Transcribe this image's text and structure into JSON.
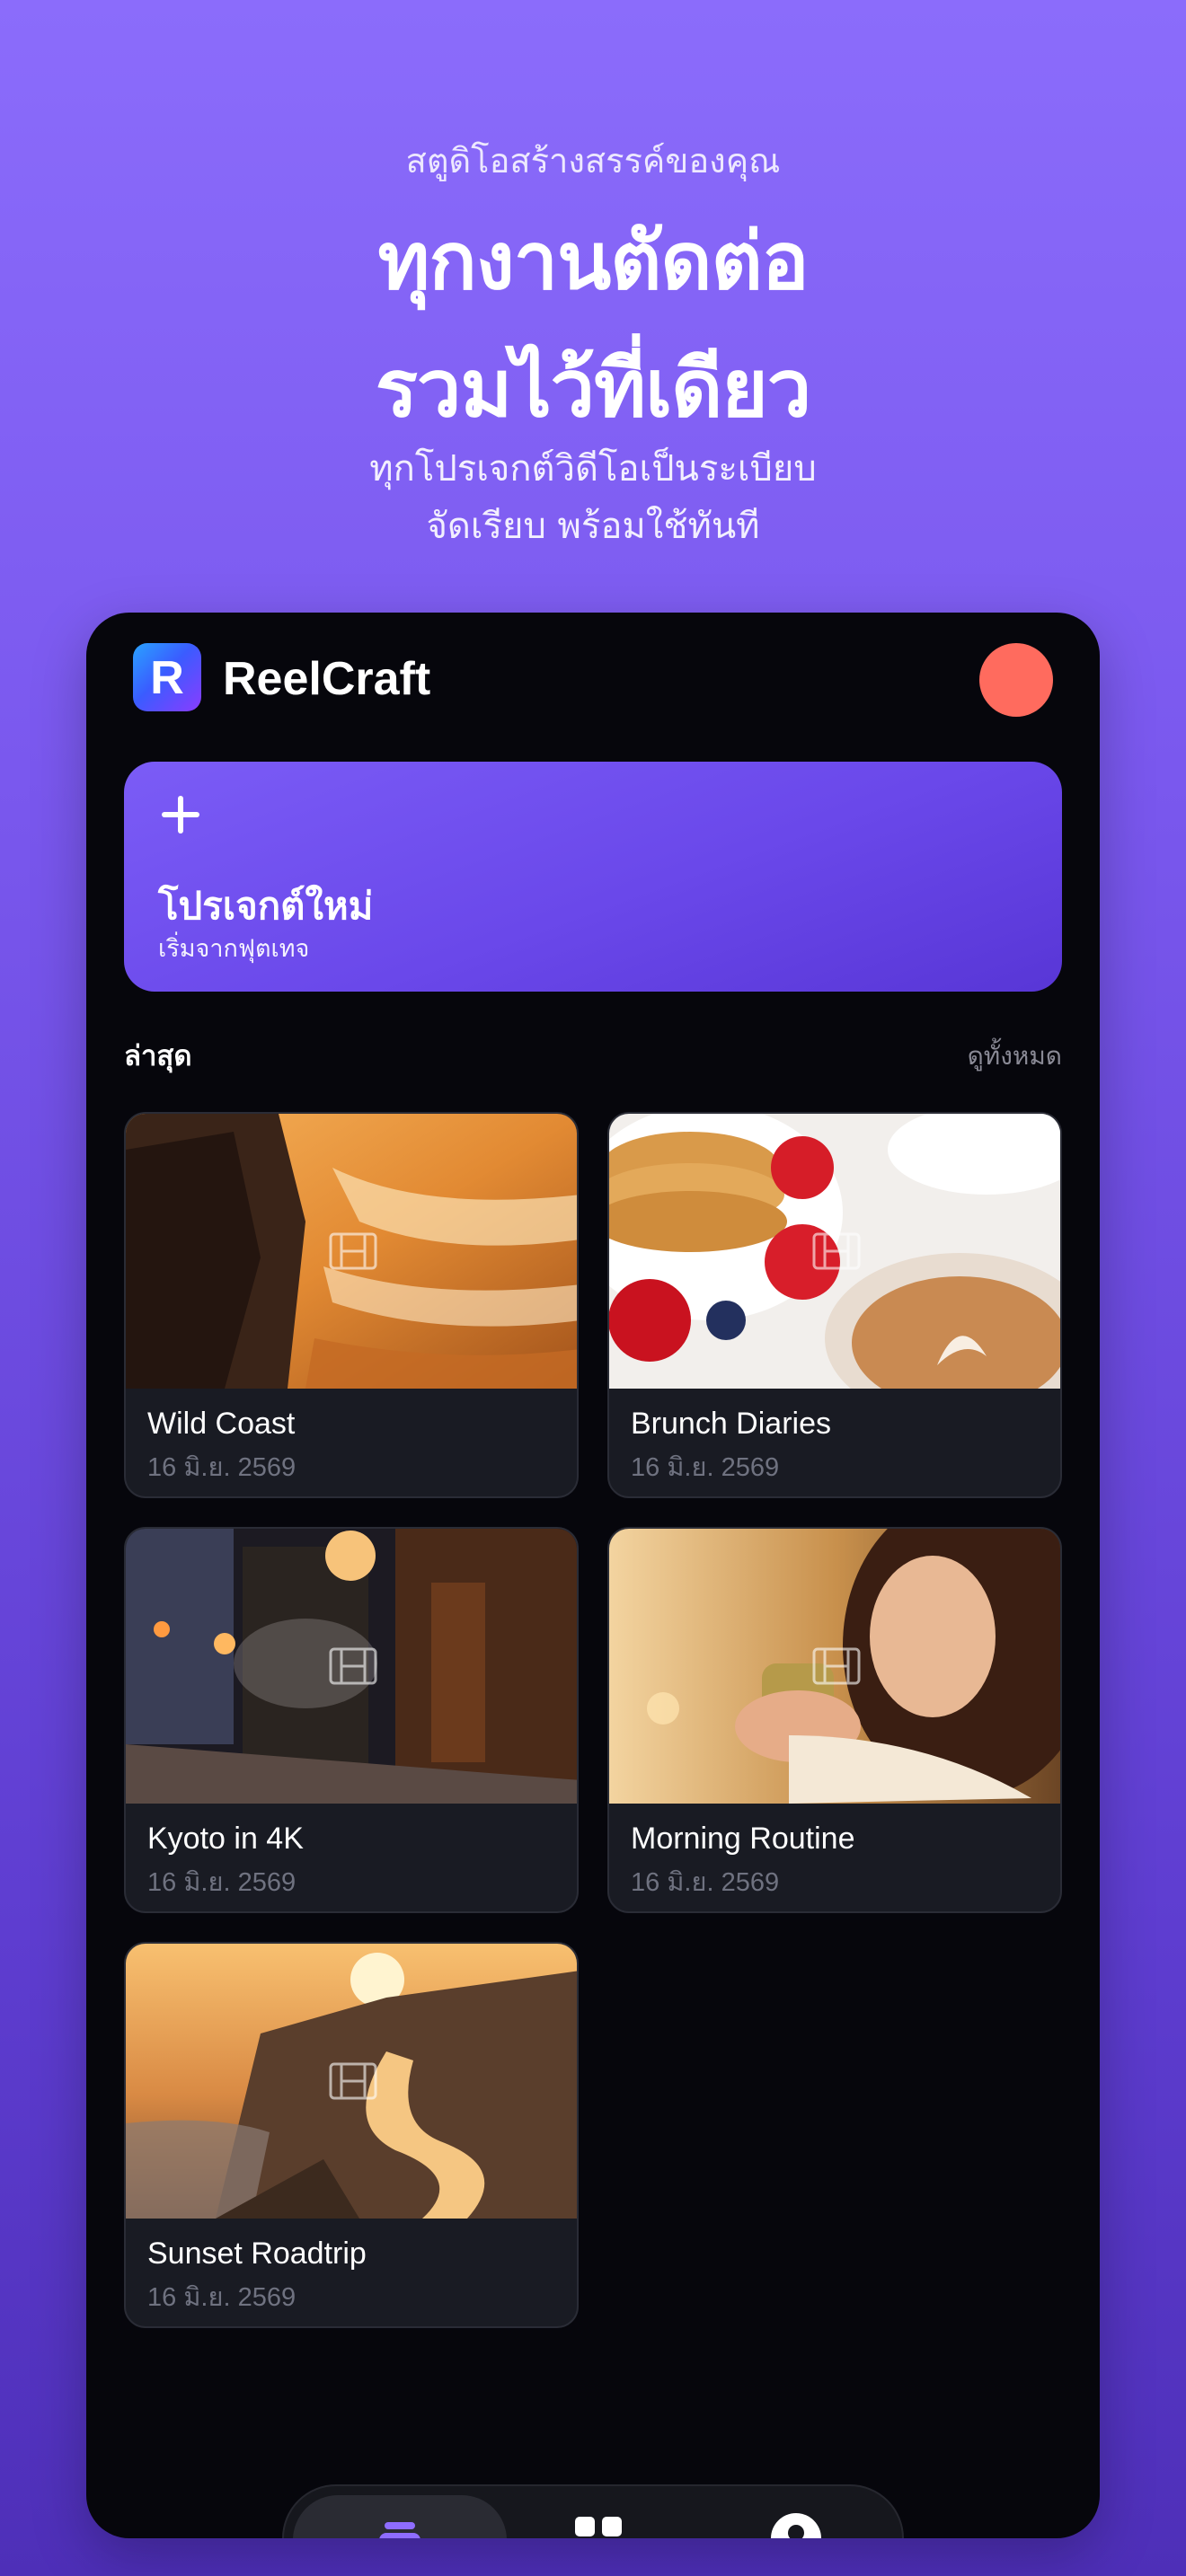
{
  "hero": {
    "kicker": "สตูดิโอสร้างสรรค์ของคุณ",
    "headline_line1": "ทุกงานตัดต่อ",
    "headline_line2": "รวมไว้ที่เดียว",
    "sub_line1": "ทุกโปรเจกต์วิดีโอเป็นระเบียบ",
    "sub_line2": "จัดเรียบ พร้อมใช้ทันที"
  },
  "app": {
    "name": "ReelCraft",
    "logo_letter": "R"
  },
  "new_project": {
    "title": "โปรเจกต์ใหม่",
    "subtitle": "เริ่มจากฟุตเทจ"
  },
  "recent": {
    "title": "ล่าสุด",
    "see_all": "ดูทั้งหมด"
  },
  "projects": [
    {
      "title": "Wild Coast",
      "date": "16 มิ.ย. 2569"
    },
    {
      "title": "Brunch Diaries",
      "date": "16 มิ.ย. 2569"
    },
    {
      "title": "Kyoto in 4K",
      "date": "16 มิ.ย. 2569"
    },
    {
      "title": "Morning Routine",
      "date": "16 มิ.ย. 2569"
    },
    {
      "title": "Sunset Roadtrip",
      "date": "16 มิ.ย. 2569"
    }
  ],
  "tabbar": {
    "tabs": [
      "home-icon",
      "grid-icon",
      "profile-icon"
    ],
    "active": 0
  },
  "colors": {
    "accent": "#7b5cf6",
    "avatar": "#ff6b5e",
    "device_bg": "#06060c"
  }
}
